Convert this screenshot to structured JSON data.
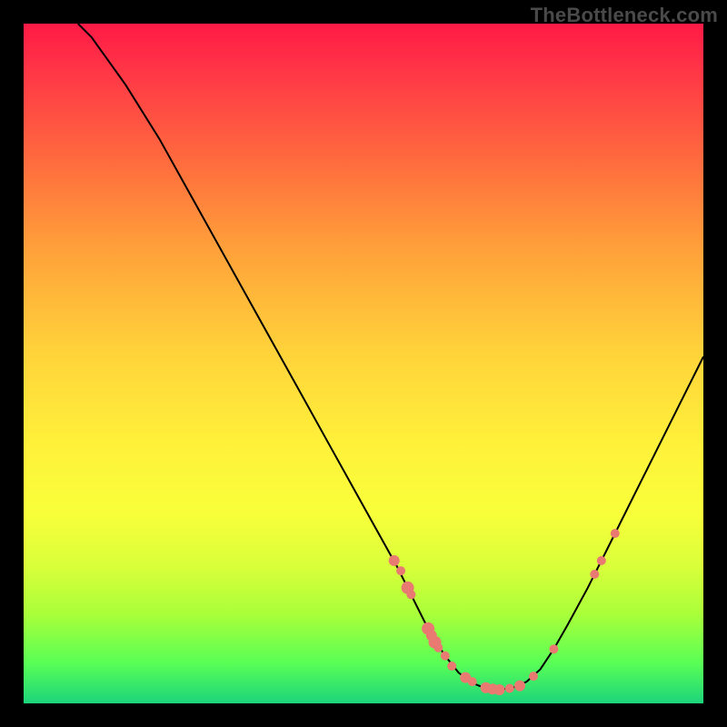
{
  "watermark": "TheBottleneck.com",
  "colors": {
    "marker": "#e87a72",
    "curve": "#000000"
  },
  "chart_data": {
    "type": "line",
    "title": "",
    "xlabel": "",
    "ylabel": "",
    "xlim": [
      0,
      100
    ],
    "ylim": [
      0,
      100
    ],
    "curve": [
      {
        "x": 8,
        "y": 100
      },
      {
        "x": 10,
        "y": 98
      },
      {
        "x": 15,
        "y": 91
      },
      {
        "x": 20,
        "y": 83
      },
      {
        "x": 25,
        "y": 74
      },
      {
        "x": 30,
        "y": 65
      },
      {
        "x": 35,
        "y": 56
      },
      {
        "x": 40,
        "y": 47
      },
      {
        "x": 45,
        "y": 38
      },
      {
        "x": 50,
        "y": 29
      },
      {
        "x": 55,
        "y": 20
      },
      {
        "x": 58,
        "y": 14
      },
      {
        "x": 60,
        "y": 10
      },
      {
        "x": 62,
        "y": 7
      },
      {
        "x": 64,
        "y": 4.5
      },
      {
        "x": 66,
        "y": 3
      },
      {
        "x": 68,
        "y": 2.2
      },
      {
        "x": 70,
        "y": 2
      },
      {
        "x": 72,
        "y": 2.3
      },
      {
        "x": 74,
        "y": 3.2
      },
      {
        "x": 76,
        "y": 5
      },
      {
        "x": 78,
        "y": 8
      },
      {
        "x": 80,
        "y": 11.5
      },
      {
        "x": 83,
        "y": 17
      },
      {
        "x": 86,
        "y": 23
      },
      {
        "x": 90,
        "y": 31
      },
      {
        "x": 95,
        "y": 41
      },
      {
        "x": 100,
        "y": 51
      }
    ],
    "markers": [
      {
        "x": 54.5,
        "y": 21,
        "r": 6
      },
      {
        "x": 55.5,
        "y": 19.5,
        "r": 5
      },
      {
        "x": 56.5,
        "y": 17,
        "r": 7
      },
      {
        "x": 57,
        "y": 16,
        "r": 5
      },
      {
        "x": 59.5,
        "y": 11,
        "r": 7
      },
      {
        "x": 60,
        "y": 10,
        "r": 6
      },
      {
        "x": 60.5,
        "y": 9,
        "r": 7
      },
      {
        "x": 61,
        "y": 8.2,
        "r": 5
      },
      {
        "x": 62,
        "y": 7,
        "r": 5
      },
      {
        "x": 63,
        "y": 5.5,
        "r": 5
      },
      {
        "x": 65,
        "y": 3.8,
        "r": 6
      },
      {
        "x": 66,
        "y": 3.2,
        "r": 5
      },
      {
        "x": 68,
        "y": 2.3,
        "r": 6
      },
      {
        "x": 69,
        "y": 2.1,
        "r": 6
      },
      {
        "x": 70,
        "y": 2,
        "r": 6
      },
      {
        "x": 71.5,
        "y": 2.2,
        "r": 5
      },
      {
        "x": 73,
        "y": 2.6,
        "r": 6
      },
      {
        "x": 75,
        "y": 4,
        "r": 5
      },
      {
        "x": 78,
        "y": 8,
        "r": 5
      },
      {
        "x": 84,
        "y": 19,
        "r": 5
      },
      {
        "x": 85,
        "y": 21,
        "r": 5
      },
      {
        "x": 87,
        "y": 25,
        "r": 5
      }
    ]
  }
}
